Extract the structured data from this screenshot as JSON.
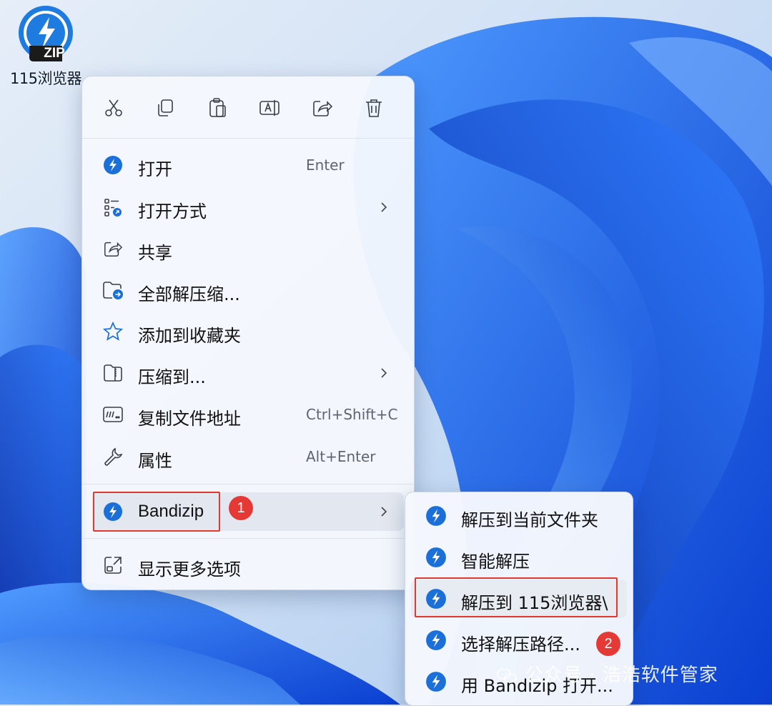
{
  "desktop": {
    "icon_badge": "ZIP",
    "icon_label": "115浏览器"
  },
  "toolbar": {
    "buttons": [
      "cut-icon",
      "copy-icon",
      "paste-icon",
      "rename-icon",
      "share-icon",
      "delete-icon"
    ]
  },
  "menu": {
    "items": [
      {
        "label": "打开",
        "shortcut": "Enter",
        "icon": "bandizip-icon"
      },
      {
        "label": "打开方式",
        "shortcut": "",
        "icon": "open-with-icon",
        "submenu": true
      },
      {
        "label": "共享",
        "shortcut": "",
        "icon": "share-icon"
      },
      {
        "label": "全部解压缩...",
        "shortcut": "",
        "icon": "extract-all-icon"
      },
      {
        "label": "添加到收藏夹",
        "shortcut": "",
        "icon": "star-icon"
      },
      {
        "label": "压缩到...",
        "shortcut": "",
        "icon": "compress-icon",
        "submenu": true
      },
      {
        "label": "复制文件地址",
        "shortcut": "Ctrl+Shift+C",
        "icon": "copy-path-icon"
      },
      {
        "label": "属性",
        "shortcut": "Alt+Enter",
        "icon": "wrench-icon"
      },
      {
        "label": "Bandizip",
        "shortcut": "",
        "icon": "bandizip-icon",
        "submenu": true
      },
      {
        "label": "显示更多选项",
        "shortcut": "",
        "icon": "more-options-icon"
      }
    ]
  },
  "submenu": {
    "items": [
      {
        "label": "解压到当前文件夹",
        "icon": "bandizip-icon"
      },
      {
        "label": "智能解压",
        "icon": "bandizip-icon"
      },
      {
        "label": "解压到 115浏览器\\",
        "icon": "bandizip-icon"
      },
      {
        "label": "选择解压路径...",
        "icon": "bandizip-icon"
      },
      {
        "label": "用 Bandizip 打开...",
        "icon": "bandizip-icon"
      }
    ]
  },
  "annotations": {
    "step1": "1",
    "step2": "2"
  },
  "watermark": "公众号 · 浩浩软件管家",
  "colors": {
    "accent": "#1a73e8",
    "bandizip_blue": "#1976d2",
    "highlight_red": "#e2382d"
  }
}
